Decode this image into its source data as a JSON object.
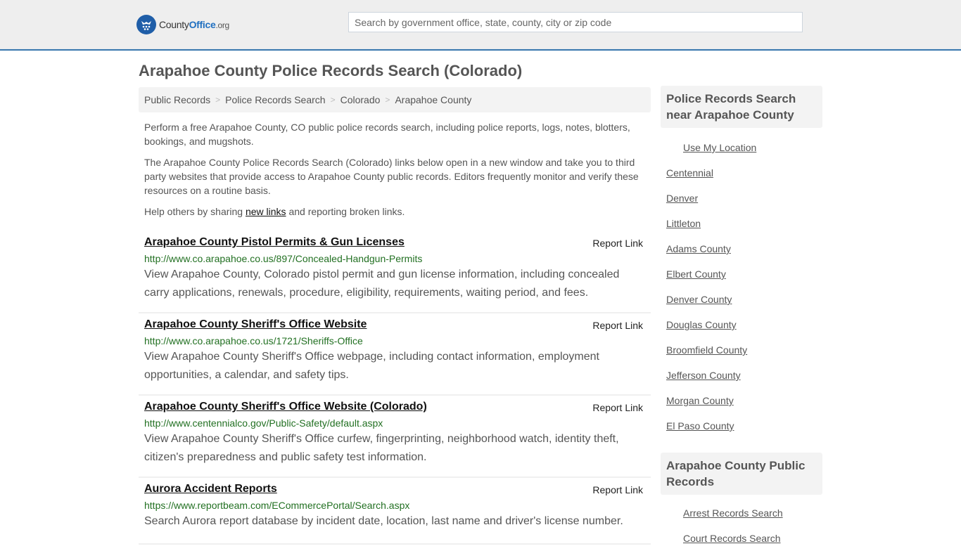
{
  "header": {
    "logo": {
      "brand_part1": "County",
      "brand_part2": "Office",
      "brand_tld": ".org"
    },
    "search_placeholder": "Search by government office, state, county, city or zip code",
    "accent_color": "#3a78ad"
  },
  "page_title": "Arapahoe County Police Records Search (Colorado)",
  "breadcrumb": [
    {
      "label": "Public Records"
    },
    {
      "label": "Police Records Search"
    },
    {
      "label": "Colorado"
    },
    {
      "label": "Arapahoe County"
    }
  ],
  "breadcrumb_separator": ">",
  "intro": {
    "p1": "Perform a free Arapahoe County, CO public police records search, including police reports, logs, notes, blotters, bookings, and mugshots.",
    "p2": "The Arapahoe County Police Records Search (Colorado) links below open in a new window and take you to third party websites that provide access to Arapahoe County public records. Editors frequently monitor and verify these resources on a routine basis.",
    "p3_before": "Help others by sharing ",
    "p3_link": "new links",
    "p3_after": " and reporting broken links."
  },
  "results": [
    {
      "title": "Arapahoe County Pistol Permits & Gun Licenses",
      "report_label": "Report Link",
      "url": "http://www.co.arapahoe.co.us/897/Concealed-Handgun-Permits",
      "description": "View Arapahoe County, Colorado pistol permit and gun license information, including concealed carry applications, renewals, procedure, eligibility, requirements, waiting period, and fees."
    },
    {
      "title": "Arapahoe County Sheriff's Office Website",
      "report_label": "Report Link",
      "url": "http://www.co.arapahoe.co.us/1721/Sheriffs-Office",
      "description": "View Arapahoe County Sheriff's Office webpage, including contact information, employment opportunities, a calendar, and safety tips."
    },
    {
      "title": "Arapahoe County Sheriff's Office Website (Colorado)",
      "report_label": "Report Link",
      "url": "http://www.centennialco.gov/Public-Safety/default.aspx",
      "description": "View Arapahoe County Sheriff's Office curfew, fingerprinting, neighborhood watch, identity theft, citizen's preparedness and public safety test information."
    },
    {
      "title": "Aurora Accident Reports",
      "report_label": "Report Link",
      "url": "https://www.reportbeam.com/ECommercePortal/Search.aspx",
      "description": "Search Aurora report database by incident date, location, last name and driver's license number."
    }
  ],
  "sidebar": {
    "nearby_heading": "Police Records Search near Arapahoe County",
    "use_location": "Use My Location",
    "nearby": [
      "Centennial",
      "Denver",
      "Littleton",
      "Adams County",
      "Elbert County",
      "Denver County",
      "Douglas County",
      "Broomfield County",
      "Jefferson County",
      "Morgan County",
      "El Paso County"
    ],
    "public_records_heading": "Arapahoe County Public Records",
    "public_records": [
      "Arrest Records Search",
      "Court Records Search"
    ]
  }
}
